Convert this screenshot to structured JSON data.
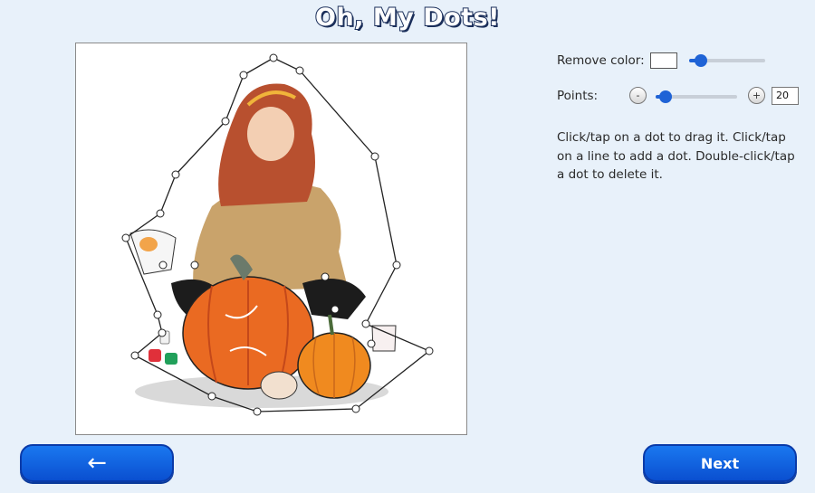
{
  "app": {
    "title": "Oh, My Dots!"
  },
  "controls": {
    "remove_color_label": "Remove color:",
    "remove_color_value": "#ffffff",
    "remove_color_slider": 0.15,
    "points_label": "Points:",
    "points_minus": "-",
    "points_plus": "+",
    "points_value": "20",
    "points_slider": 0.12
  },
  "help_text": "Click/tap on a dot to drag it. Click/tap on a line to add a dot. Double-click/tap a dot to delete it.",
  "nav": {
    "back_icon": "arrow-left-icon",
    "back_glyph": "←",
    "next_label": "Next"
  },
  "colors": {
    "accent": "#1f63d6",
    "button": "#0a5ae0",
    "background": "#e8f1fa"
  }
}
